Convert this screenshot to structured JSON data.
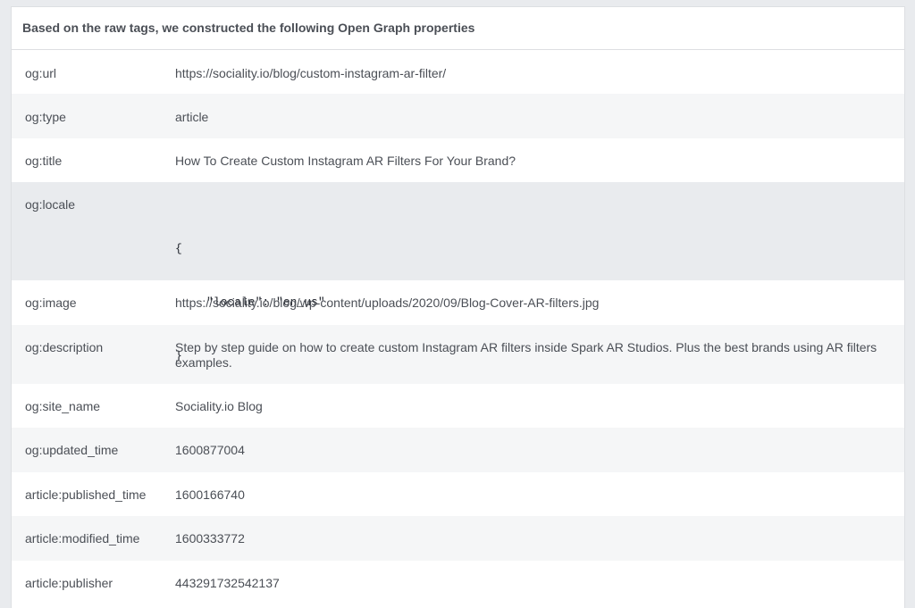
{
  "header": {
    "title": "Based on the raw tags, we constructed the following Open Graph properties"
  },
  "rows": [
    {
      "key": "og:url",
      "value": "https://sociality.io/blog/custom-instagram-ar-filter/"
    },
    {
      "key": "og:type",
      "value": "article"
    },
    {
      "key": "og:title",
      "value": "How To Create Custom Instagram AR Filters For Your Brand?"
    },
    {
      "key": "og:locale",
      "json_open": "{",
      "json_line": "\"locale\": \"en_us\"",
      "json_close": "}"
    },
    {
      "key": "og:image",
      "value": "https://sociality.io/blog/wp-content/uploads/2020/09/Blog-Cover-AR-filters.jpg"
    },
    {
      "key": "og:description",
      "value": "Step by step guide on how to create custom Instagram AR filters inside Spark AR Studios. Plus the best brands using AR filters examples."
    },
    {
      "key": "og:site_name",
      "value": "Sociality.io Blog"
    },
    {
      "key": "og:updated_time",
      "value": "1600877004"
    },
    {
      "key": "article:published_time",
      "value": "1600166740"
    },
    {
      "key": "article:modified_time",
      "value": "1600333772"
    },
    {
      "key": "article:publisher",
      "value": "443291732542137"
    }
  ]
}
